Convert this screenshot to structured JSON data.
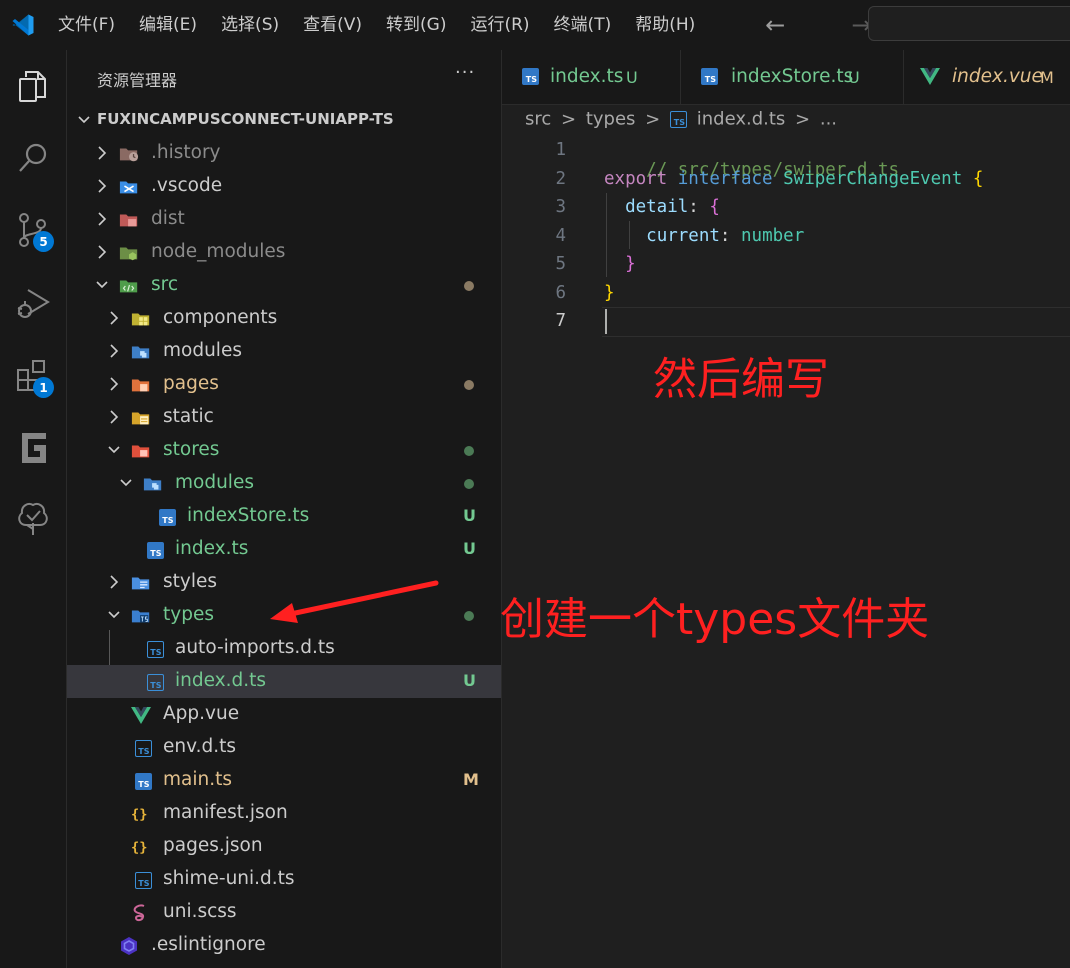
{
  "menu": [
    "文件(F)",
    "编辑(E)",
    "选择(S)",
    "查看(V)",
    "转到(G)",
    "运行(R)",
    "终端(T)",
    "帮助(H)"
  ],
  "nav": {
    "back": "←",
    "forward": "→"
  },
  "activity": {
    "scm_badge": "5",
    "extensions_badge": "1"
  },
  "explorer": {
    "title": "资源管理器",
    "more": "···",
    "root": "FUXINCAMPUSCONNECT-UNIAPP-TS",
    "items": [
      {
        "label": ".history"
      },
      {
        "label": ".vscode"
      },
      {
        "label": "dist"
      },
      {
        "label": "node_modules"
      },
      {
        "label": "src"
      },
      {
        "label": "components"
      },
      {
        "label": "modules"
      },
      {
        "label": "pages"
      },
      {
        "label": "static"
      },
      {
        "label": "stores"
      },
      {
        "label": "modules"
      },
      {
        "label": "indexStore.ts",
        "decoration": "U"
      },
      {
        "label": "index.ts",
        "decoration": "U"
      },
      {
        "label": "styles"
      },
      {
        "label": "types"
      },
      {
        "label": "auto-imports.d.ts"
      },
      {
        "label": "index.d.ts",
        "decoration": "U"
      },
      {
        "label": "App.vue"
      },
      {
        "label": "env.d.ts"
      },
      {
        "label": "main.ts",
        "decoration": "M"
      },
      {
        "label": "manifest.json"
      },
      {
        "label": "pages.json"
      },
      {
        "label": "shime-uni.d.ts"
      },
      {
        "label": "uni.scss"
      },
      {
        "label": ".eslintignore"
      }
    ]
  },
  "tabs": [
    {
      "label": "index.ts",
      "decoration": "U"
    },
    {
      "label": "indexStore.ts",
      "decoration": "U"
    },
    {
      "label": "index.vue",
      "decoration": "M"
    }
  ],
  "breadcrumb": {
    "seg1": "src",
    "seg2": "types",
    "seg3": "index.d.ts",
    "seg4": "...",
    "sep": ">"
  },
  "code": {
    "line_numbers": [
      "1",
      "2",
      "3",
      "4",
      "5",
      "6",
      "7"
    ],
    "comment": "// src/types/swiper.d.ts",
    "kw_export": "export",
    "kw_interface": "interface",
    "type_name": "SwiperChangeEvent",
    "brace_open": "{",
    "prop_detail": "detail",
    "colon": ":",
    "prop_current": "current",
    "type_number": "number",
    "brace_close": "}"
  },
  "annotations": {
    "create_folder": "创建一个types文件夹",
    "then_write": "然后编写"
  },
  "colors": {
    "accent": "#0078d4",
    "untracked": "#73c991",
    "modified": "#e2c08d",
    "annotation": "#ff2020"
  }
}
